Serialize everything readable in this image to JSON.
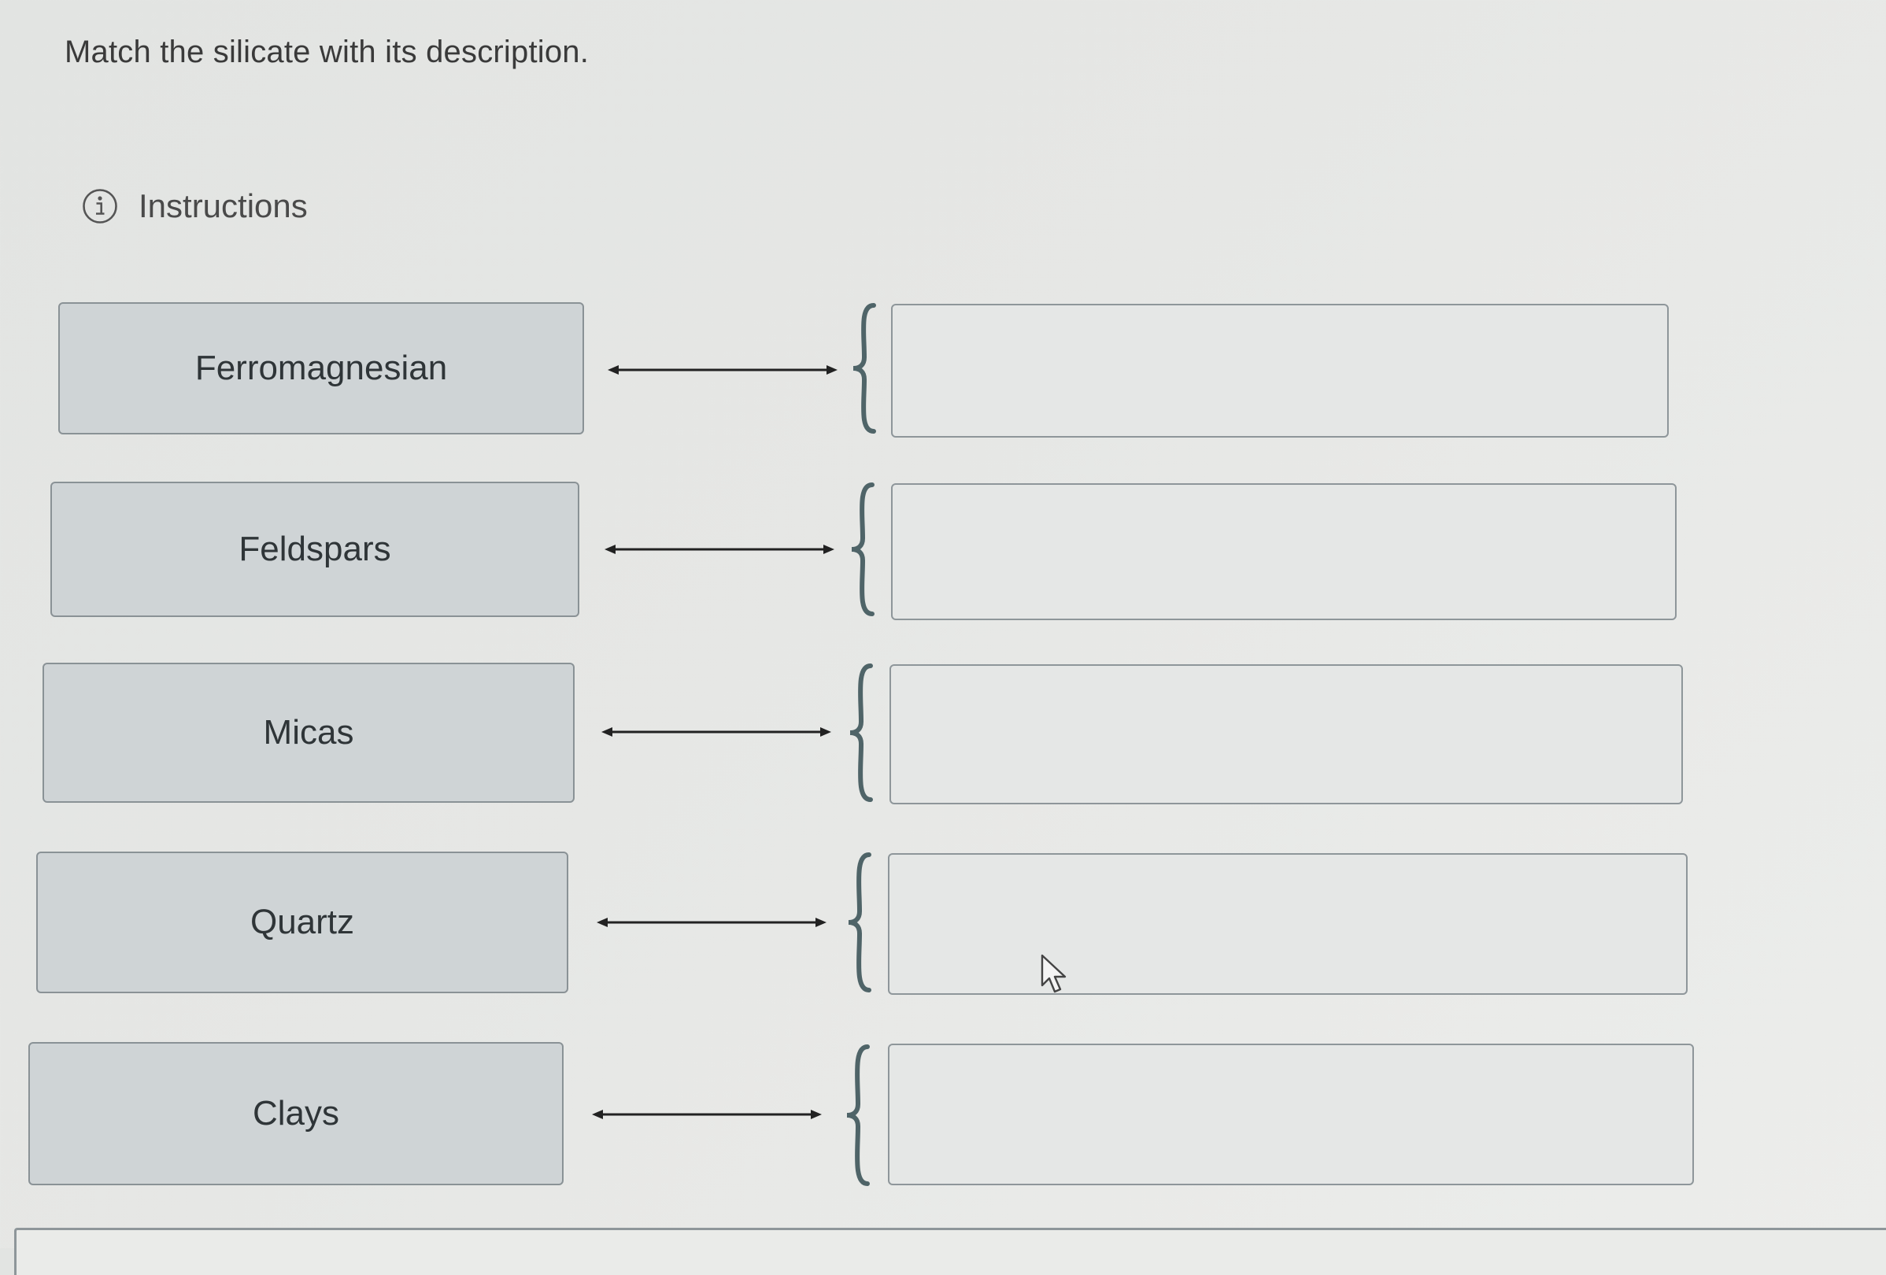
{
  "question": {
    "text": "Match the silicate with its description."
  },
  "instructions": {
    "label": "Instructions",
    "icon": "info-circle-icon"
  },
  "pairs": [
    {
      "term": "Ferromagnesian",
      "description": ""
    },
    {
      "term": "Feldspars",
      "description": ""
    },
    {
      "term": "Micas",
      "description": ""
    },
    {
      "term": "Quartz",
      "description": ""
    },
    {
      "term": "Clays",
      "description": ""
    }
  ],
  "colors": {
    "background": "#e6e7e5",
    "term_fill": "#cfd4d6",
    "term_border": "#8a9296",
    "brace": "#4f6468",
    "arrow": "#222222",
    "dropzone_fill": "#e5e7e6"
  }
}
